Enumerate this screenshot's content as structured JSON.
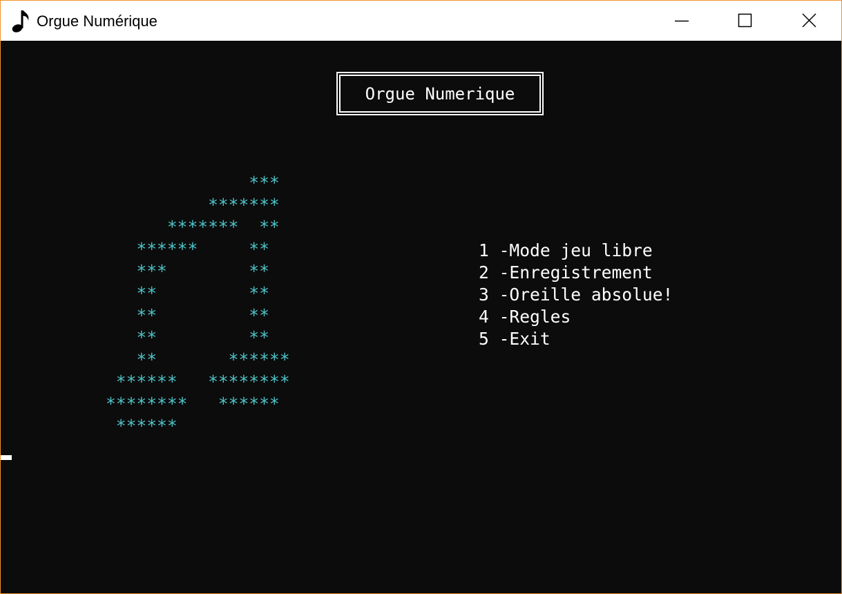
{
  "window": {
    "title": "Orgue Numérique",
    "app_icon": "music-note-icon",
    "controls": [
      "minimize-icon",
      "maximize-icon",
      "close-icon"
    ],
    "border_color": "#f0922a"
  },
  "console": {
    "background": "#0c0c0c",
    "banner": "Orgue Numerique",
    "art_color": "#4fc3c8",
    "art_lines": [
      "              ***",
      "          *******",
      "      *******  **",
      "   ******     **",
      "   ***        **",
      "   **         **",
      "   **         **",
      "   **         **",
      "   **       ******",
      " ******   ********",
      "********   ******",
      " ******"
    ],
    "menu_items": [
      "1 -Mode jeu libre",
      "2 -Enregistrement",
      "3 -Oreille absolue!",
      "4 -Regles",
      "5 -Exit"
    ]
  }
}
